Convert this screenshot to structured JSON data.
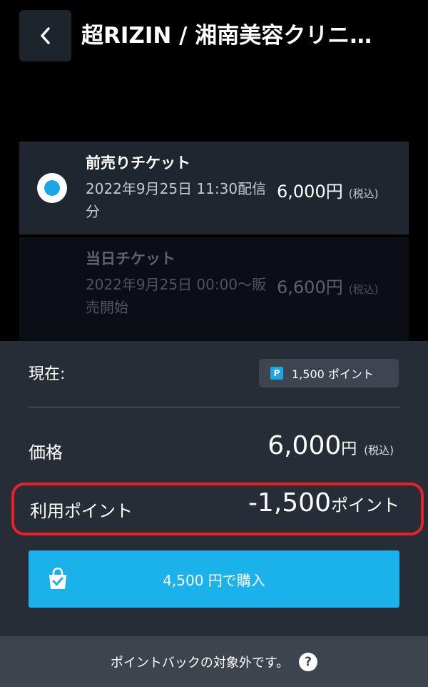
{
  "header": {
    "back_icon": "chevron-left-icon",
    "title": "超RIZIN / 湘南美容クリニ…"
  },
  "tickets": [
    {
      "name": "前売りチケット",
      "desc": "2022年9月25日 11:30配信分",
      "price": "6,000円",
      "tax": "(税込)",
      "selected": true,
      "enabled": true
    },
    {
      "name": "当日チケット",
      "desc": "2022年9月25日 00:00〜販売開始",
      "price": "6,600円",
      "tax": "(税込)",
      "selected": false,
      "enabled": false
    }
  ],
  "sheet": {
    "current_label": "現在:",
    "points_icon": "P",
    "points_balance": "1,500 ポイント",
    "price_label": "価格",
    "price_value": "6,000",
    "price_unit": "円",
    "price_tax": "(税込)",
    "use_points_label": "利用ポイント",
    "use_points_value": "-1,500",
    "use_points_unit": "ポイント",
    "buy_icon": "shopping-bag-check-icon",
    "buy_label": "4,500 円で購入"
  },
  "footer": {
    "text": "ポイントバックの対象外です。",
    "help_icon": "?"
  },
  "colors": {
    "accent": "#1bb2ec",
    "highlight_border": "#e8202a",
    "sheet_bg": "#262d37"
  }
}
